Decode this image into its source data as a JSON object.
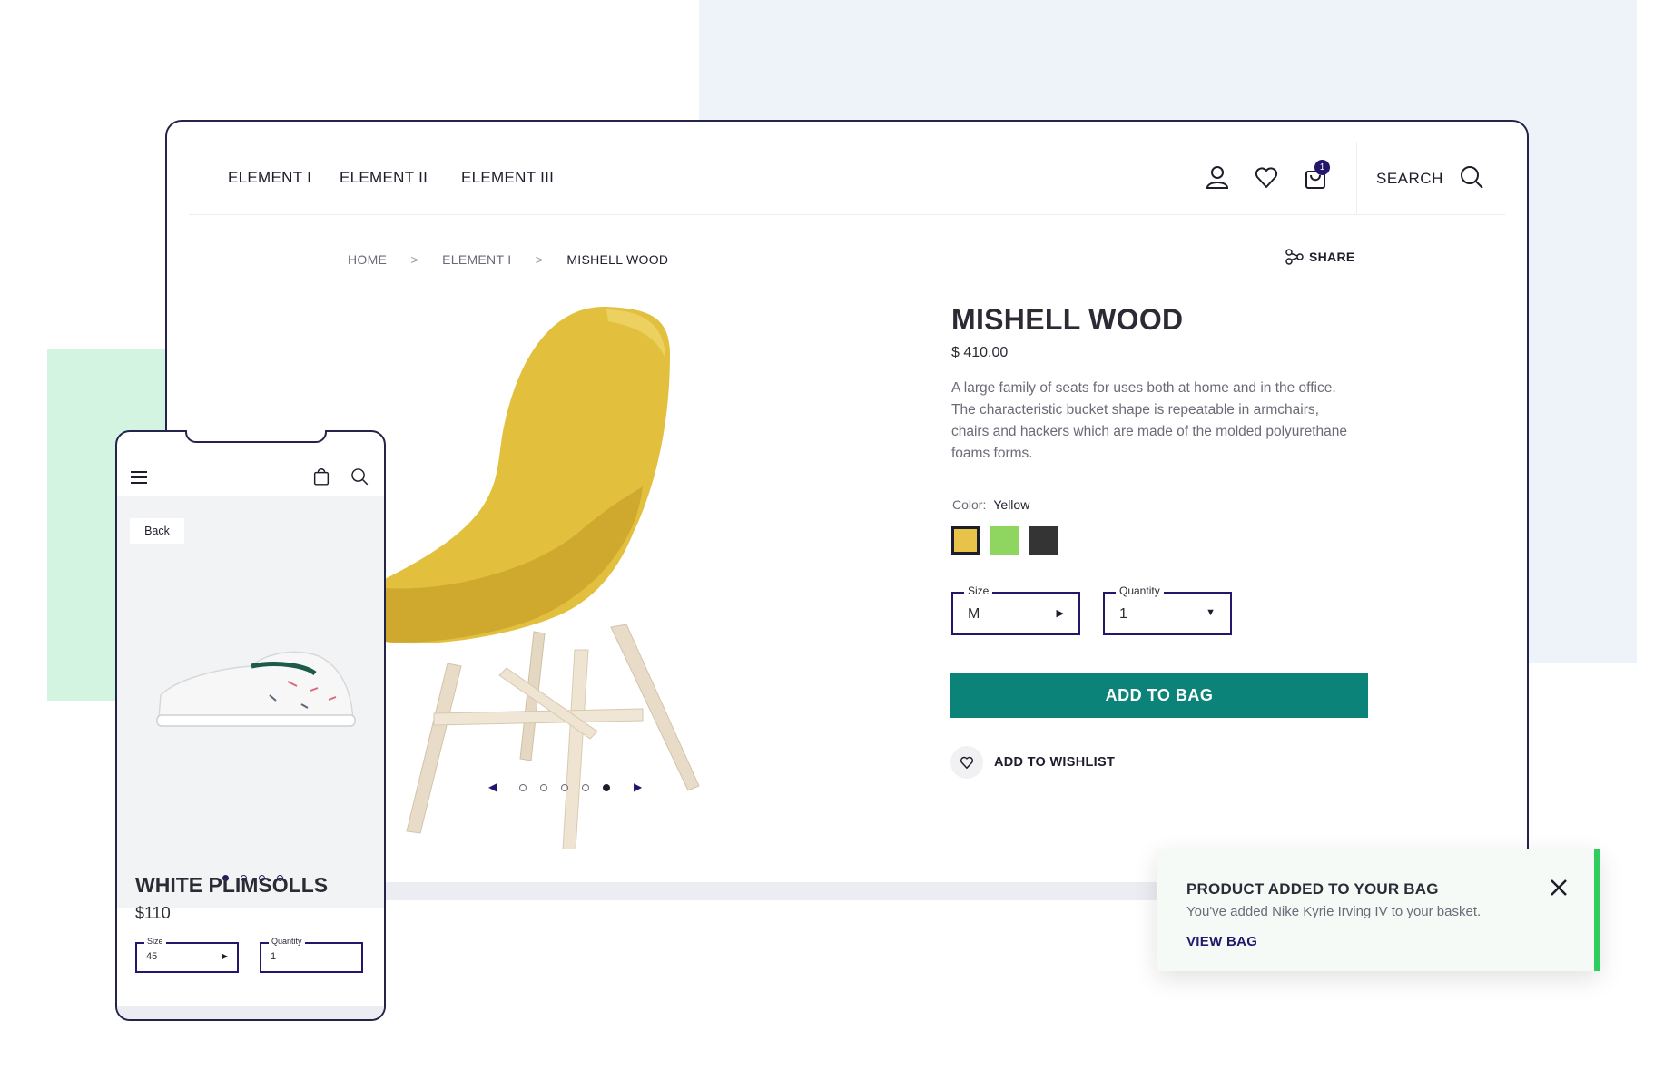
{
  "nav": {
    "items": [
      {
        "label": "ELEMENT I"
      },
      {
        "label": "ELEMENT II"
      },
      {
        "label": "ELEMENT III"
      }
    ],
    "cart_count": "1",
    "search_label": "SEARCH",
    "icons": [
      "user-icon",
      "heart-icon",
      "bag-icon",
      "search-icon"
    ]
  },
  "breadcrumb": {
    "items": [
      {
        "label": "HOME"
      },
      {
        "label": "ELEMENT I"
      },
      {
        "label": "MISHELL WOOD"
      }
    ],
    "separator": ">"
  },
  "share_label": "SHARE",
  "carousel": {
    "slides": 5,
    "active_index": 4
  },
  "product": {
    "title": "MISHELL WOOD",
    "price": "$ 410.00",
    "description": "A large family of seats for uses both at home and in the office. The characteristic bucket shape is repeatable in armchairs, chairs and hackers which are made of the molded polyurethane foams forms.",
    "color_label": "Color:",
    "color_value": "Yellow",
    "swatches": [
      {
        "name": "yellow",
        "hex": "#e7c449",
        "selected": true
      },
      {
        "name": "green",
        "hex": "#8ed65f",
        "selected": false
      },
      {
        "name": "dark",
        "hex": "#343434",
        "selected": false
      }
    ],
    "size": {
      "label": "Size",
      "value": "M"
    },
    "quantity": {
      "label": "Quantity",
      "value": "1"
    },
    "add_to_bag": "ADD TO BAG",
    "add_to_wishlist": "ADD TO WISHLIST"
  },
  "mobile": {
    "back_label": "Back",
    "title": "WHITE PLIMSOLLS",
    "price": "$110",
    "size": {
      "label": "Size",
      "value": "45"
    },
    "quantity": {
      "label": "Quantity",
      "value": "1"
    },
    "carousel": {
      "slides": 4,
      "active_index": 0
    }
  },
  "toast": {
    "title": "PRODUCT ADDED TO YOUR BAG",
    "message": "You've added Nike Kyrie Irving IV to your basket.",
    "link": "VIEW BAG"
  },
  "colors": {
    "accent": "#0b8378",
    "brand": "#24176b",
    "success": "#2fcc5e"
  }
}
